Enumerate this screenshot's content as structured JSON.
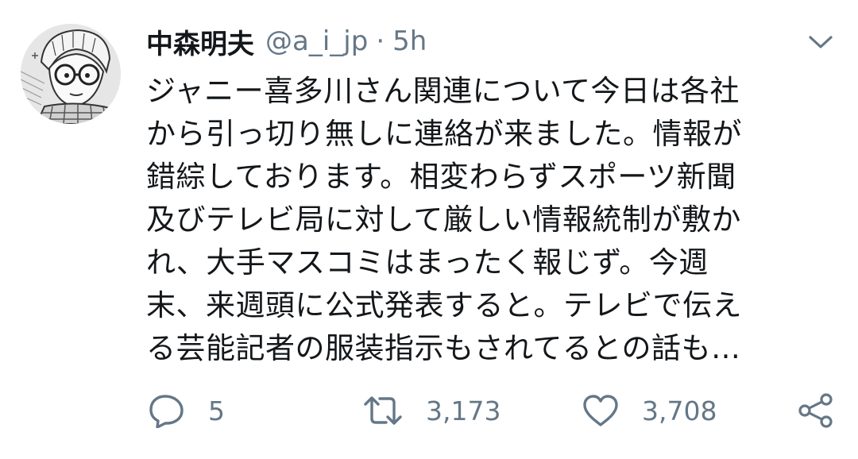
{
  "tweet": {
    "display_name": "中森明夫",
    "handle": "@a_i_jp",
    "separator": "·",
    "time": "5h",
    "text": "ジャニー喜多川さん関連について今日は各社\nから引っ切り無しに連絡が来ました。情報が\n錯綜しております。相変わらずスポーツ新聞\n及びテレビ局に対して厳しい情報統制が敷か\nれ、大手マスコミはまったく報じず。今週\n末、来週頭に公式発表すると。テレビで伝え\nる芸能記者の服装指示もされてるとの話も…"
  },
  "actions": {
    "reply_count": "5",
    "retweet_count": "3,173",
    "like_count": "3,708"
  },
  "icons": {
    "avatar": "manga-avatar",
    "caret": "chevron-down-icon",
    "reply": "reply-icon",
    "retweet": "retweet-icon",
    "like": "heart-icon",
    "share": "share-icon"
  },
  "colors": {
    "text": "#14171a",
    "secondary": "#657786",
    "background": "#ffffff"
  }
}
